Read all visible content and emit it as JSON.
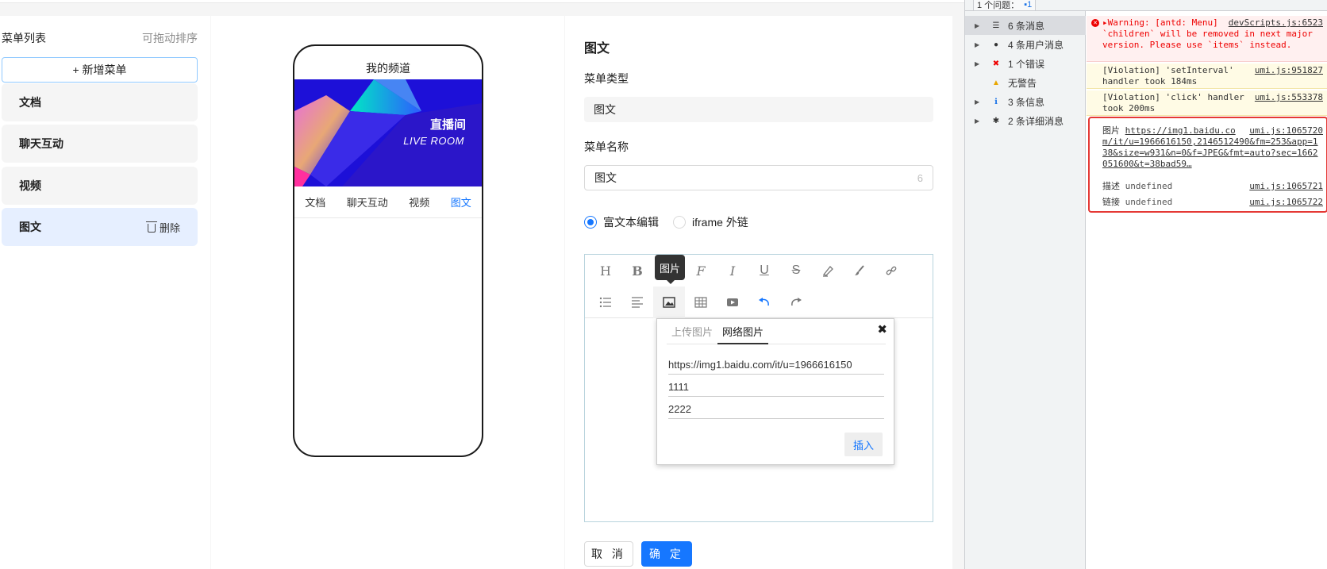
{
  "menu": {
    "title": "菜单列表",
    "sort_hint": "可拖动排序",
    "add_label": "+ 新增菜单",
    "items": [
      {
        "label": "文档"
      },
      {
        "label": "聊天互动"
      },
      {
        "label": "视频"
      },
      {
        "label": "图文",
        "delete_label": "删除"
      }
    ]
  },
  "phone": {
    "title": "我的频道",
    "banner_cn": "直播间",
    "banner_en": "LIVE ROOM",
    "tabs": [
      "文档",
      "聊天互动",
      "视频",
      "图文"
    ],
    "active_tab": "图文"
  },
  "form": {
    "title": "图文",
    "type_label": "菜单类型",
    "type_value": "图文",
    "name_label": "菜单名称",
    "name_value": "图文",
    "name_count": "6",
    "radio_richtext": "富文本编辑",
    "radio_iframe": "iframe 外链",
    "tooltip": "图片",
    "popup": {
      "tab_upload": "上传图片",
      "tab_network": "网络图片",
      "url_value": "https://img1.baidu.com/it/u=1966616150",
      "desc_value": "1111",
      "link_value": "2222",
      "insert_label": "插入"
    },
    "cancel_label": "取 消",
    "ok_label": "确 定"
  },
  "devtools": {
    "issues_label": "1 个问题：",
    "issues_count": "1",
    "sidebar": [
      {
        "label": "6 条消息",
        "icon": "list-icon"
      },
      {
        "label": "4 条用户消息",
        "icon": "user-icon"
      },
      {
        "label": "1 个错误",
        "icon": "error-icon"
      },
      {
        "label": "无警告",
        "icon": "warning-icon"
      },
      {
        "label": "3 条信息",
        "icon": "info-icon"
      },
      {
        "label": "2 条详细消息",
        "icon": "bug-icon"
      }
    ],
    "console": {
      "error_text": "▸Warning: [antd: Menu] `children` will be removed in next major version. Please use `items` instead.",
      "error_src": "devScripts.js:6523",
      "v1_text": "[Violation] 'setInterval' handler took 184ms",
      "v1_src": "umi.js:951827",
      "v2_text": "[Violation] 'click' handler took 200ms",
      "v2_src": "umi.js:553378",
      "log1_label": "图片",
      "log1_value": "https://img1.baidu.com/it/u=1966616150,2146512490&fm=253&app=138&size=w931&n=0&f=JPEG&fmt=auto?sec=1662051600&t=38bad59…",
      "log1_src": "umi.js:1065720",
      "log2_label": "描述",
      "log2_value": "undefined",
      "log2_src": "umi.js:1065721",
      "log3_label": "链接",
      "log3_value": "undefined",
      "log3_src": "umi.js:1065722"
    }
  }
}
